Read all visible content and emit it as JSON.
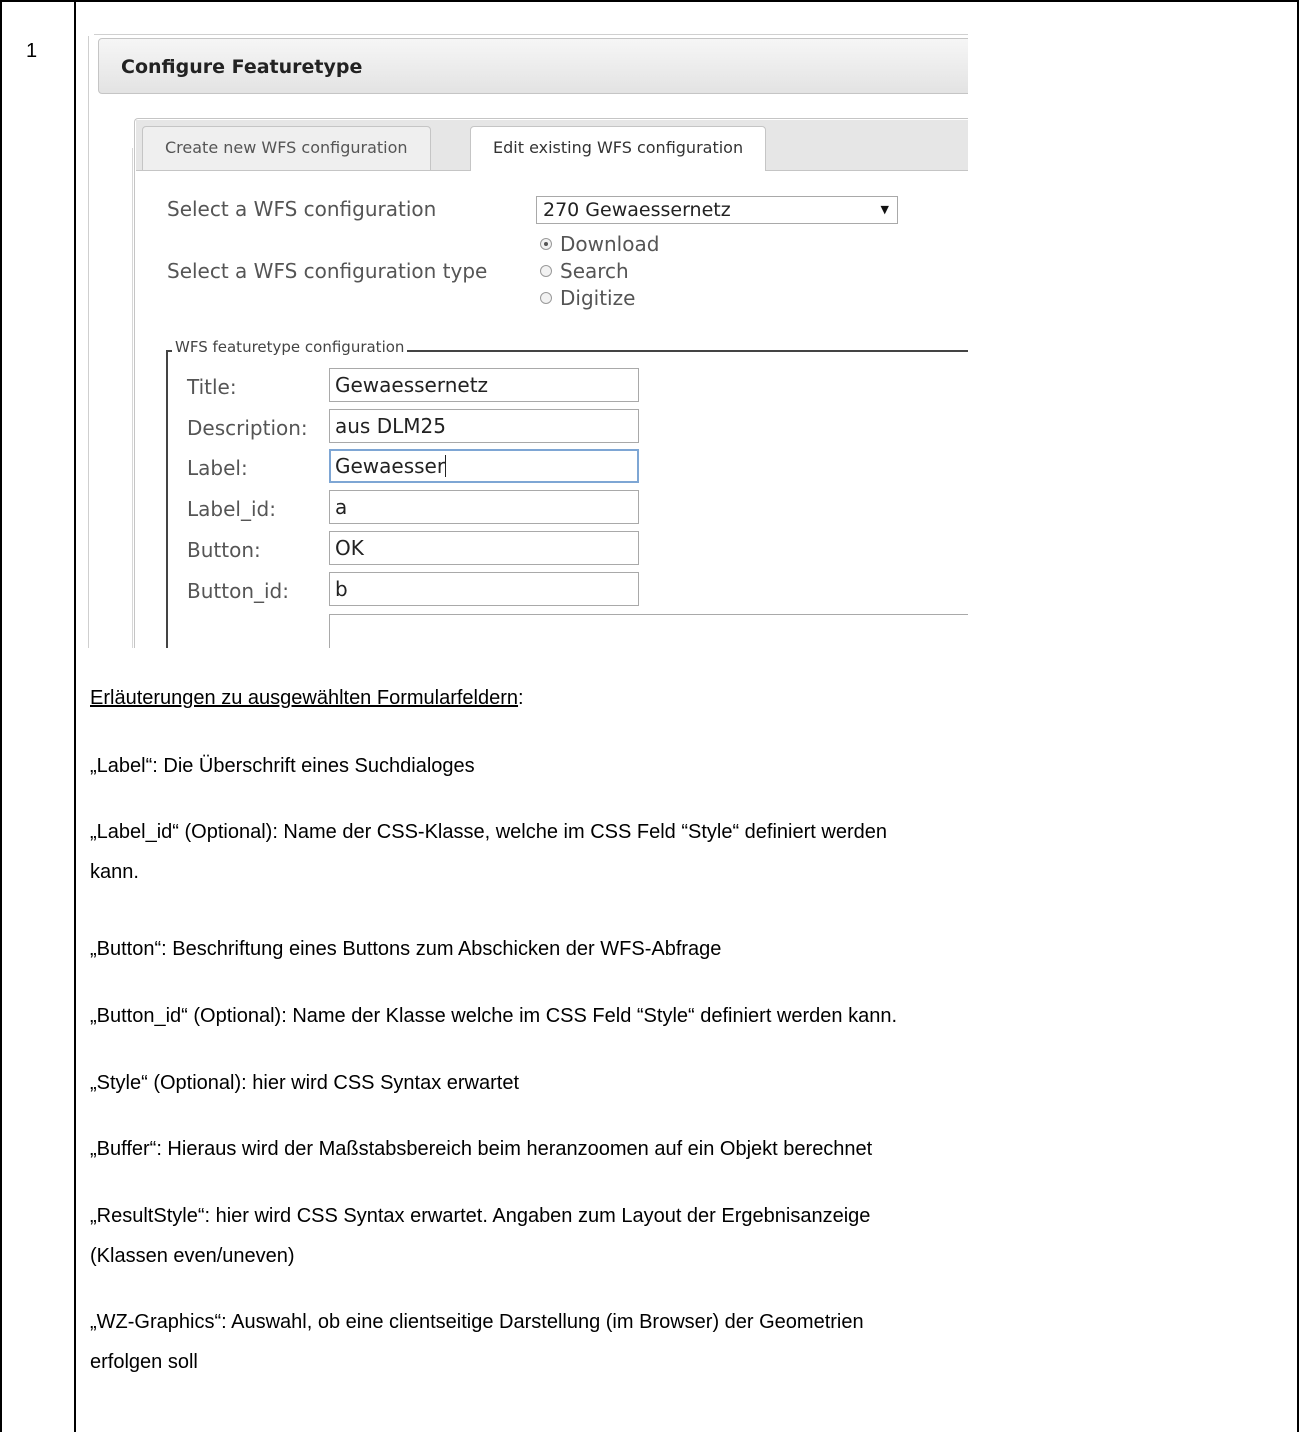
{
  "row_number": "1",
  "ui": {
    "panel_title": "Configure Featuretype",
    "tabs": [
      {
        "label": "Create new WFS configuration"
      },
      {
        "label": "Edit existing WFS configuration"
      }
    ],
    "select_config_label": "Select a WFS configuration",
    "select_config_value": "270 Gewaessernetz",
    "config_type_label": "Select a WFS configuration type",
    "config_types": [
      {
        "label": "Download",
        "checked": true
      },
      {
        "label": "Search",
        "checked": false
      },
      {
        "label": "Digitize",
        "checked": false
      }
    ],
    "fieldset_legend": "WFS featuretype configuration",
    "fields": [
      {
        "label": "Title:",
        "value": "Gewaessernetz"
      },
      {
        "label": "Description:",
        "value": "aus DLM25"
      },
      {
        "label": "Label:",
        "value": "Gewaesser"
      },
      {
        "label": "Label_id:",
        "value": "a"
      },
      {
        "label": "Button:",
        "value": "OK"
      },
      {
        "label": "Button_id:",
        "value": "b"
      }
    ]
  },
  "explanation": {
    "heading": "Erläuterungen zu ausgewählten Formularfeldern",
    "heading_suffix": ":",
    "lines": [
      "„Label“: Die Überschrift eines Suchdialoges",
      "„Label_id“ (Optional): Name der CSS-Klasse, welche im CSS Feld “Style“ definiert werden",
      "kann.",
      "„Button“: Beschriftung eines Buttons zum Abschicken der WFS-Abfrage",
      "„Button_id“ (Optional): Name der Klasse welche im CSS Feld “Style“ definiert werden kann.",
      "„Style“ (Optional): hier wird CSS Syntax erwartet",
      "„Buffer“: Hieraus wird der Maßstabsbereich beim heranzoomen auf ein Objekt berechnet",
      "„ResultStyle“: hier wird CSS Syntax erwartet. Angaben zum Layout der Ergebnisanzeige",
      "(Klassen even/uneven)",
      "„WZ-Graphics“: Auswahl, ob eine clientseitige Darstellung (im Browser) der Geometrien",
      "erfolgen soll"
    ]
  }
}
